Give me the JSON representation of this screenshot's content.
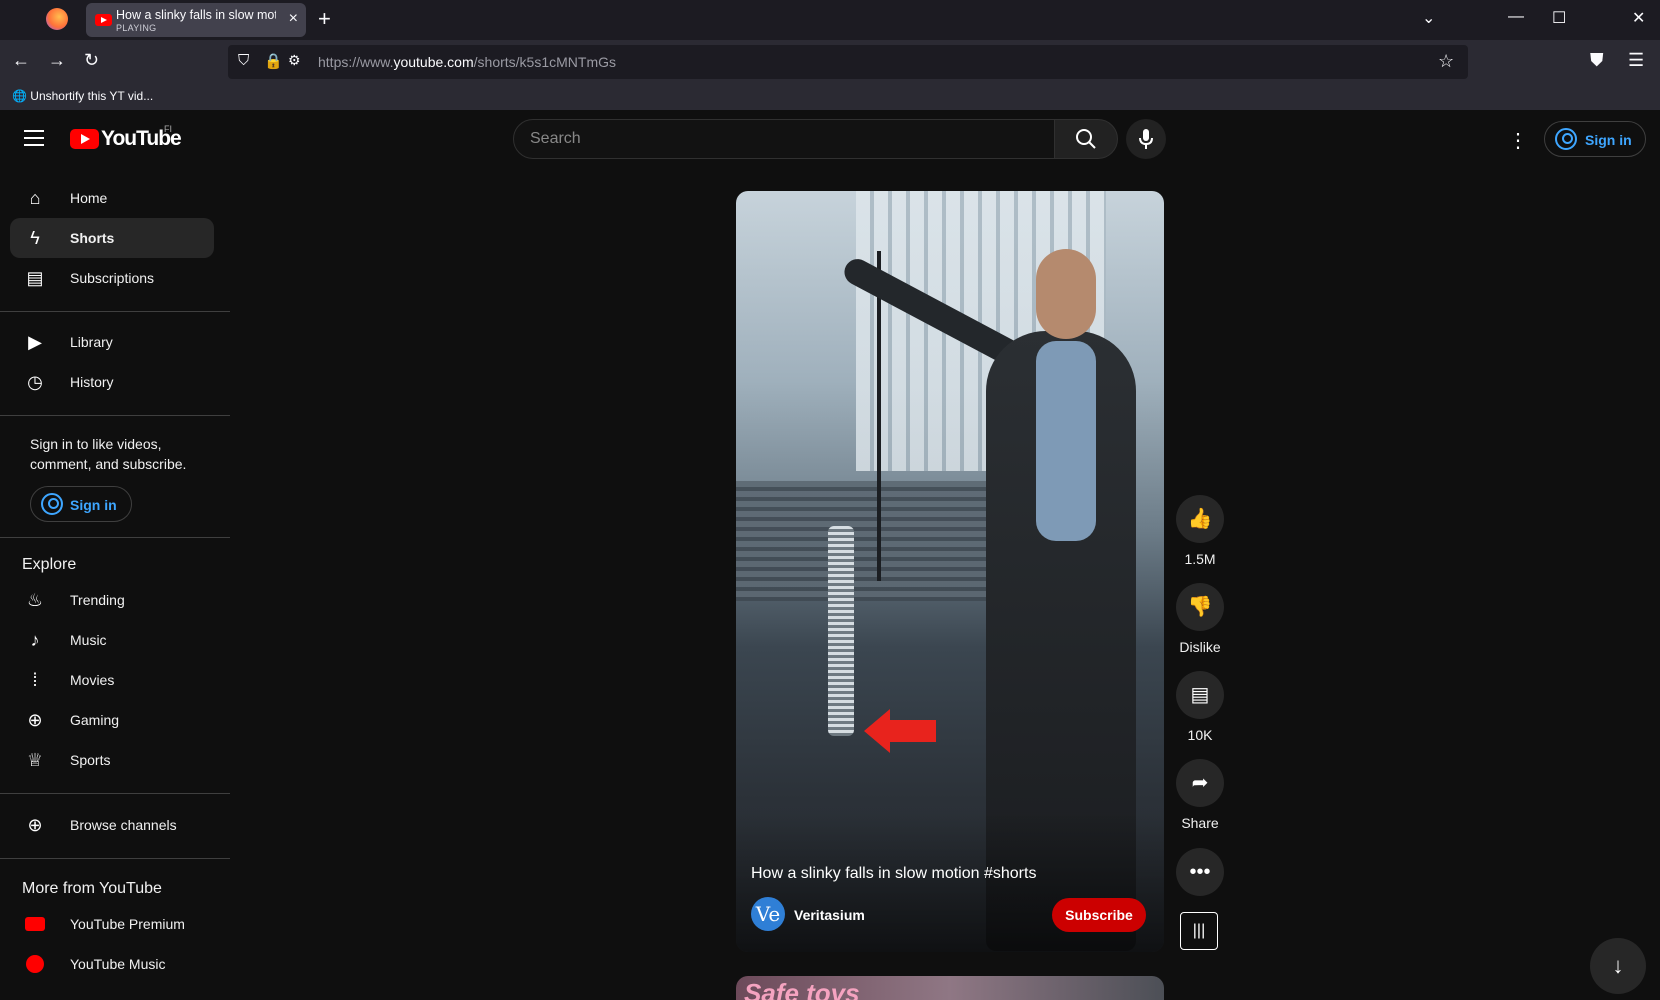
{
  "browser": {
    "tab_title": "How a slinky falls in slow motion #shorts - YouTube",
    "tab_status": "PLAYING",
    "url_prefix": "https://www.",
    "url_domain": "youtube.com",
    "url_path": "/shorts/k5s1cMNTmGs",
    "bookmark": "Unshortify this YT vid..."
  },
  "header": {
    "logo_text": "YouTube",
    "logo_country": "FI",
    "search_placeholder": "Search",
    "sign_in": "Sign in"
  },
  "sidebar": {
    "main": [
      {
        "label": "Home",
        "icon": "home-icon"
      },
      {
        "label": "Shorts",
        "icon": "shorts-icon"
      },
      {
        "label": "Subscriptions",
        "icon": "subscriptions-icon"
      }
    ],
    "you": [
      {
        "label": "Library",
        "icon": "library-icon"
      },
      {
        "label": "History",
        "icon": "history-icon"
      }
    ],
    "signin_message": "Sign in to like videos, comment, and subscribe.",
    "signin_button": "Sign in",
    "explore_title": "Explore",
    "explore": [
      {
        "label": "Trending",
        "icon": "trending-icon"
      },
      {
        "label": "Music",
        "icon": "music-icon"
      },
      {
        "label": "Movies",
        "icon": "movies-icon"
      },
      {
        "label": "Gaming",
        "icon": "gaming-icon"
      },
      {
        "label": "Sports",
        "icon": "sports-icon"
      }
    ],
    "browse_channels": "Browse channels",
    "more_title": "More from YouTube",
    "more": [
      {
        "label": "YouTube Premium",
        "icon": "youtube-premium-icon"
      },
      {
        "label": "YouTube Music",
        "icon": "youtube-music-icon"
      }
    ]
  },
  "video": {
    "title": "How a slinky falls in slow motion #shorts",
    "channel": "Veritasium",
    "channel_avatar": "Ve",
    "subscribe": "Subscribe",
    "next_preview_text": "Safe toys"
  },
  "actions": {
    "likes": "1.5M",
    "dislike": "Dislike",
    "comments": "10K",
    "share": "Share"
  },
  "colors": {
    "brand_red": "#ff0000",
    "link_blue": "#3ea6ff",
    "background": "#0f0f0f"
  }
}
